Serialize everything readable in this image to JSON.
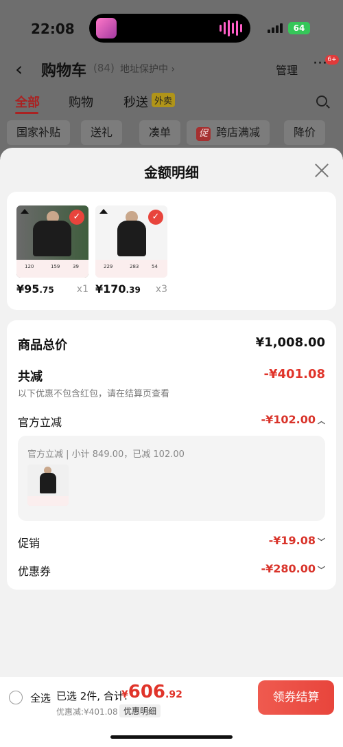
{
  "status": {
    "time": "22:08",
    "battery": "64"
  },
  "nav": {
    "title": "购物车",
    "count": "(84)",
    "address": "地址保护中 ›",
    "manage": "管理",
    "more": "···",
    "badge": "6+"
  },
  "tabs": [
    {
      "label": "全部",
      "active": true
    },
    {
      "label": "购物"
    },
    {
      "label": "秒送"
    }
  ],
  "tab_tag": "外卖",
  "chips": [
    "国家补贴",
    "送礼",
    "凑单",
    "跨店满减",
    "降价"
  ],
  "chip_promo": "促",
  "sheet": {
    "title": "金额明细",
    "products": [
      {
        "price_int": "¥95",
        "price_dec": ".75",
        "qty": "x1",
        "strip": [
          "120",
          "159",
          "39"
        ]
      },
      {
        "price_int": "¥170",
        "price_dec": ".39",
        "qty": "x3",
        "strip": [
          "229",
          "283",
          "54"
        ]
      }
    ],
    "total_label": "商品总价",
    "total_value": "¥1,008.00",
    "reduce_label": "共减",
    "reduce_value": "-¥401.08",
    "reduce_note": "以下优惠不包含红包，请在结算页查看",
    "official_label": "官方立减",
    "official_value": "-¥102.00",
    "official_sub": "官方立减 | 小计 849.00，已减 102.00",
    "promo_label": "促销",
    "promo_value": "-¥19.08",
    "coupon_label": "优惠券",
    "coupon_value": "-¥280.00"
  },
  "bar": {
    "select_all": "全选",
    "selected": "已选 2件, 合计:",
    "total_cur": "¥",
    "total_int": "606",
    "total_dec": ".92",
    "discount": "优惠减:¥401.08",
    "detail": "优惠明细",
    "checkout": "领券结算"
  },
  "colors": {
    "accent": "#e0342a",
    "checkout": "#e8453c",
    "battery": "#35c759"
  }
}
